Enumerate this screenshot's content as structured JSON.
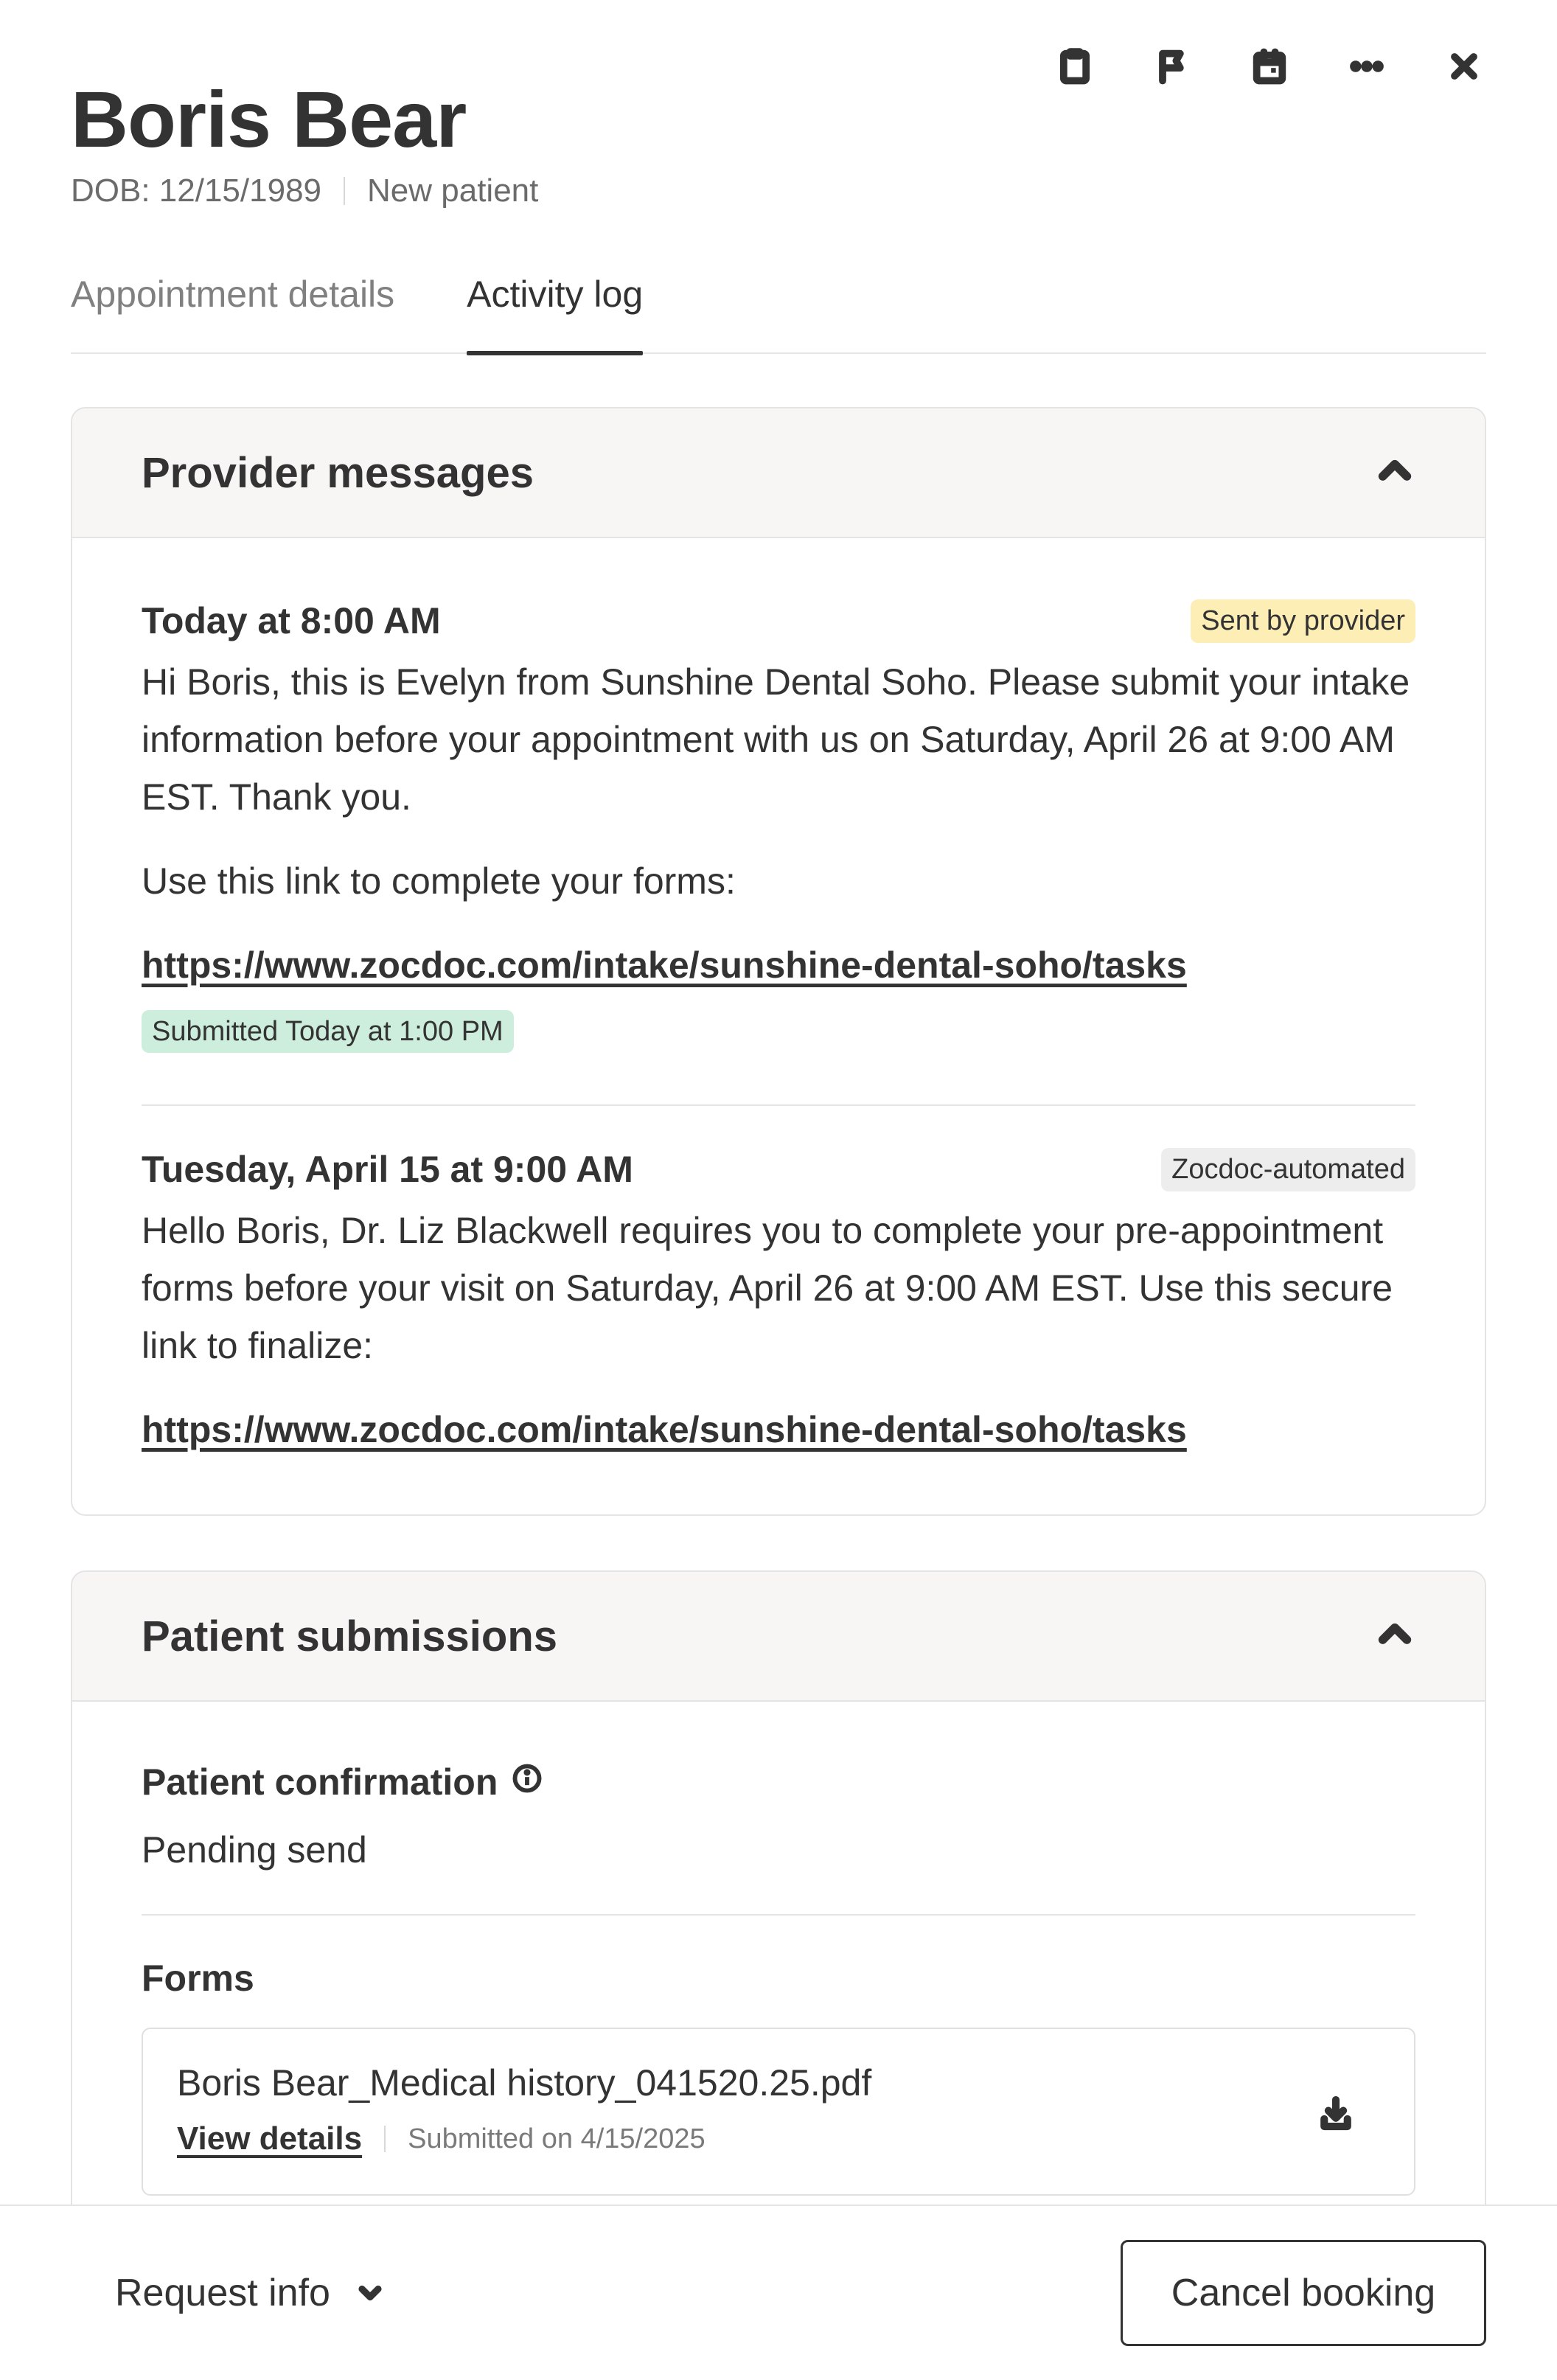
{
  "toolbar": {
    "icons": [
      "clipboard-icon",
      "flag-icon",
      "calendar-icon",
      "more-icon",
      "close-icon"
    ]
  },
  "patient": {
    "name": "Boris Bear",
    "dob": "DOB: 12/15/1989",
    "status": "New patient"
  },
  "tabs": [
    {
      "label": "Appointment details",
      "active": false
    },
    {
      "label": "Activity log",
      "active": true
    }
  ],
  "provider_messages": {
    "title": "Provider messages",
    "messages": [
      {
        "time": "Today at 8:00 AM",
        "badge": "Sent by provider",
        "body": "Hi Boris, this is Evelyn from Sunshine Dental Soho. Please submit your intake information before your appointment with us on Saturday, April 26 at 9:00 AM EST. Thank you.",
        "body2": "Use this link to complete your forms:",
        "link": "https://www.zocdoc.com/intake/sunshine-dental-soho/tasks",
        "status": "Submitted Today at 1:00 PM"
      },
      {
        "time": "Tuesday, April 15 at 9:00 AM",
        "badge": "Zocdoc-automated",
        "body": "Hello Boris, Dr. Liz Blackwell requires you to complete your pre-appointment forms before your visit on Saturday, April 26 at 9:00 AM EST. Use this secure link to finalize:",
        "link": "https://www.zocdoc.com/intake/sunshine-dental-soho/tasks"
      }
    ]
  },
  "patient_submissions": {
    "title": "Patient submissions",
    "confirmation_label": "Patient confirmation",
    "confirmation_value": "Pending send",
    "forms_label": "Forms",
    "forms": [
      {
        "file_name": "Boris Bear_Medical history_041520.25.pdf",
        "view_label": "View details",
        "submitted": "Submitted on 4/15/2025"
      }
    ]
  },
  "footer": {
    "request_info": "Request info",
    "cancel_booking": "Cancel booking"
  }
}
